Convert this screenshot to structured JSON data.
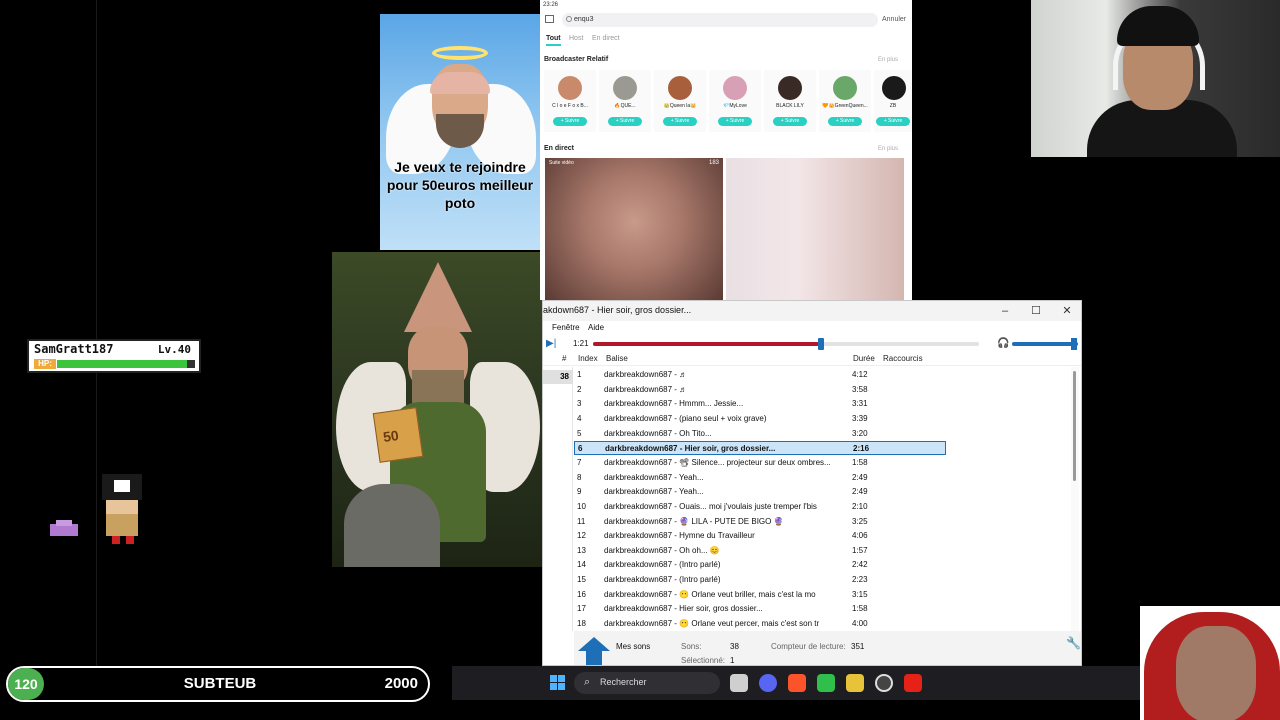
{
  "memes": {
    "angel_caption": "Je veux te rejoindre pour 50euros meilleur poto",
    "bill_value": "50"
  },
  "player": {
    "name": "SamGratt187",
    "level": "Lv.40",
    "hp_label": "HP:",
    "hp_fraction": 0.94
  },
  "subs": {
    "count": "120",
    "title": "SUBTEUB",
    "goal": "2000"
  },
  "phone": {
    "status_time": "23:26",
    "search_value": "enqu3",
    "cancel": "Annuler",
    "tabs": [
      "Tout",
      "Host",
      "En direct"
    ],
    "broadcaster_title": "Broadcaster Relatif",
    "more": "En plus",
    "broadcasters": [
      {
        "name": "C l o e F o x B...",
        "avatar_color": "#c98a6c"
      },
      {
        "name": "🔥QUE...",
        "avatar_color": "#9a9a92"
      },
      {
        "name": "👑Queen la👑",
        "avatar_color": "#a8603c"
      },
      {
        "name": "💎MyLove",
        "avatar_color": "#d8a0b4"
      },
      {
        "name": "BLACK LILY",
        "avatar_color": "#3a2a26"
      },
      {
        "name": "🧡👑GreenQueen...",
        "avatar_color": "#6aa86a"
      },
      {
        "name": "ZB",
        "avatar_color": "#1a1a1a"
      }
    ],
    "follow_label": "+ Suivre",
    "live_title": "En direct",
    "live_tiles": [
      {
        "count": "183",
        "tag": "Suite vidéo"
      },
      {
        "count": "",
        "tag": ""
      }
    ]
  },
  "media_player": {
    "window_title": "akdown687 - Hier soir, gros dossier...",
    "menu": [
      "Fenêtre",
      "Aide"
    ],
    "time_elapsed": "1:21",
    "seek_fraction": 0.59,
    "columns": {
      "num": "#",
      "index": "Index",
      "tag": "Balise",
      "duration": "Durée",
      "shortcuts": "Raccourcis"
    },
    "left_count": "38",
    "tracks": [
      {
        "index": "1",
        "title": "darkbreakdown687 - ♬",
        "duration": "4:12"
      },
      {
        "index": "2",
        "title": "darkbreakdown687 - ♬",
        "duration": "3:58"
      },
      {
        "index": "3",
        "title": "darkbreakdown687 - Hmmm... Jessie...",
        "duration": "3:31"
      },
      {
        "index": "4",
        "title": "darkbreakdown687 - (piano seul + voix grave)",
        "duration": "3:39"
      },
      {
        "index": "5",
        "title": "darkbreakdown687 - Oh Tito...",
        "duration": "3:20"
      },
      {
        "index": "6",
        "title": "darkbreakdown687 - Hier soir, gros dossier...",
        "duration": "2:16",
        "selected": true
      },
      {
        "index": "7",
        "title": "darkbreakdown687 - 📽 Silence... projecteur sur deux ombres...",
        "duration": "1:58"
      },
      {
        "index": "8",
        "title": "darkbreakdown687 - Yeah...",
        "duration": "2:49"
      },
      {
        "index": "9",
        "title": "darkbreakdown687 - Yeah...",
        "duration": "2:49"
      },
      {
        "index": "10",
        "title": "darkbreakdown687 - Ouais... moi j'voulais juste tremper l'bis",
        "duration": "2:10"
      },
      {
        "index": "11",
        "title": "darkbreakdown687 - 🔮 LILA - PUTE DE BIGO 🔮",
        "duration": "3:25"
      },
      {
        "index": "12",
        "title": "darkbreakdown687 - Hymne du Travailleur",
        "duration": "4:06"
      },
      {
        "index": "13",
        "title": "darkbreakdown687 - Oh oh... 😊",
        "duration": "1:57"
      },
      {
        "index": "14",
        "title": "darkbreakdown687 - (Intro parlé)",
        "duration": "2:42"
      },
      {
        "index": "15",
        "title": "darkbreakdown687 - (Intro parlé)",
        "duration": "2:23"
      },
      {
        "index": "16",
        "title": "darkbreakdown687 - 😶 Orlane veut briller, mais c'est la mo",
        "duration": "3:15"
      },
      {
        "index": "17",
        "title": "darkbreakdown687 - Hier soir, gros dossier...",
        "duration": "1:58"
      },
      {
        "index": "18",
        "title": "darkbreakdown687 - 😶 Orlane veut percer, mais c'est son tr",
        "duration": "4:00"
      }
    ],
    "status": {
      "home_label": "Mes sons",
      "sons_label": "Sons:",
      "sons_value": "38",
      "selected_label": "Sélectionné:",
      "selected_value": "1",
      "counter_label": "Compteur de lecture:",
      "counter_value": "351"
    }
  },
  "taskbar": {
    "search_placeholder": "Rechercher",
    "apps": [
      "file-explorer-icon",
      "discord-icon",
      "brave-icon",
      "notepad-icon",
      "game-icon",
      "obs-icon",
      "youtube-icon"
    ]
  }
}
